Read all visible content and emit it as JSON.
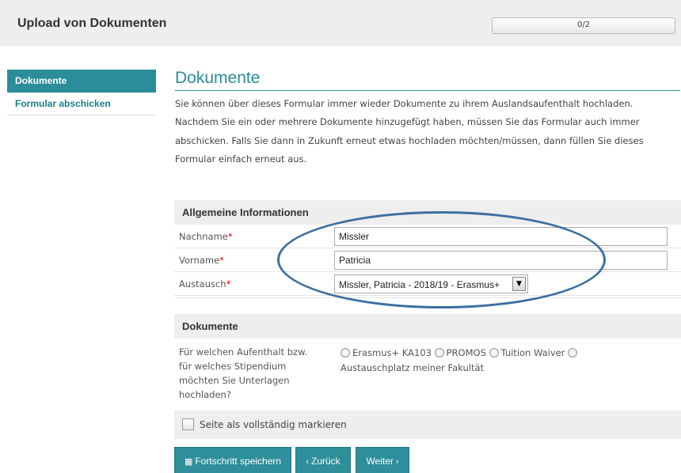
{
  "header": {
    "title": "Upload von Dokumenten",
    "progress_text": "0/2",
    "progress_fraction": 0.0
  },
  "sidebar": {
    "items": [
      {
        "label": "Dokumente",
        "active": true
      },
      {
        "label": "Formular abschicken",
        "active": false
      }
    ]
  },
  "main": {
    "title": "Dokumente",
    "intro": "Sie können über dieses Formular immer wieder Dokumente zu ihrem Auslandsaufenthalt hochladen. Nachdem Sie ein oder mehrere Dokumente hinzugefügt haben, müssen Sie das Formular auch immer abschicken. Falls Sie dann in Zukunft erneut etwas hochladen möchten/müssen, dann füllen Sie dieses Formular einfach erneut aus.",
    "general": {
      "heading": "Allgemeine Informationen",
      "fields": [
        {
          "label": "Nachname",
          "value": "Missler"
        },
        {
          "label": "Vorname",
          "value": "Patricia"
        },
        {
          "label": "Austausch",
          "value": "Missler, Patricia - 2018/19 - Erasmus+"
        }
      ]
    },
    "documents": {
      "heading": "Dokumente",
      "question": "Für welchen Aufenthalt bzw. für welches Stipendium möchten Sie Unterlagen hochladen?",
      "options": [
        "Erasmus+ KA103",
        "PROMOS",
        "Tuition Waiver",
        "Austauschplatz meiner Fakultät"
      ]
    },
    "complete_label": "Seite als vollständig markieren",
    "buttons": {
      "save": "Fortschritt speichern",
      "back": "Zurück",
      "next": "Weiter"
    }
  },
  "colors": {
    "accent": "#2b8d99",
    "annotation_ellipse": "#3c6fa0",
    "required": "#dd0000"
  }
}
